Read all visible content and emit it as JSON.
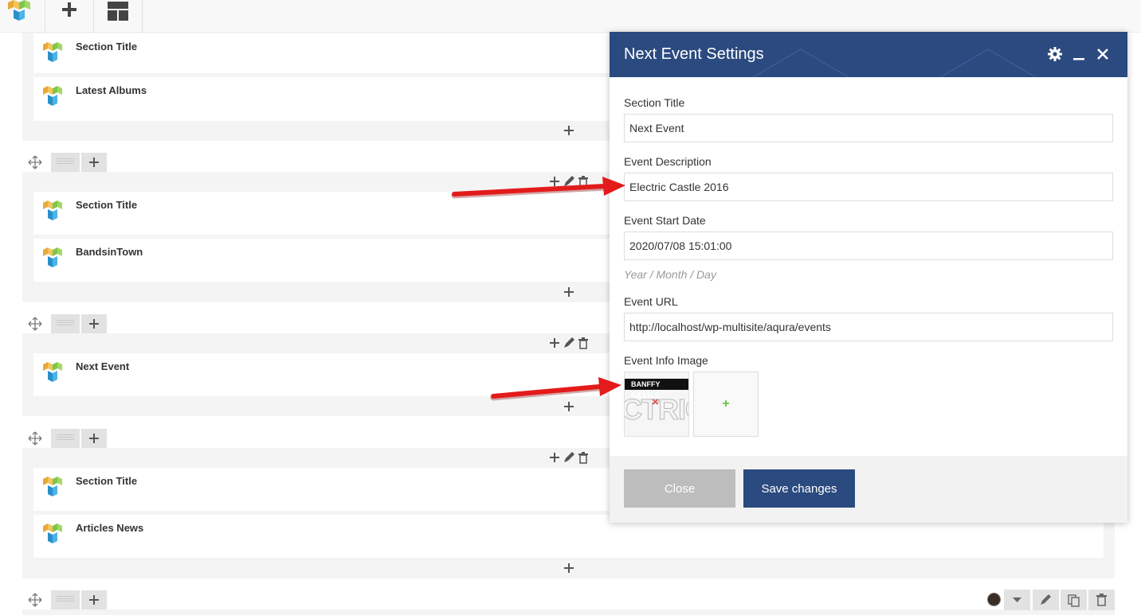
{
  "toolbar": {
    "logo_icon": "visual-composer-logo-icon",
    "add_icon": "plus-icon",
    "layout_icon": "layout-icon"
  },
  "rows": [
    {
      "elements": [
        "Section Title",
        "Latest Albums"
      ]
    },
    {
      "elements": [
        "Section Title",
        "BandsinTown"
      ]
    },
    {
      "elements": [
        "Next Event"
      ]
    },
    {
      "elements": [
        "Section Title",
        "Articles News"
      ]
    }
  ],
  "modal": {
    "title": "Next Event Settings",
    "fields": {
      "section_title": {
        "label": "Section Title",
        "value": "Next Event"
      },
      "event_description": {
        "label": "Event Description",
        "value": "Electric Castle 2016"
      },
      "event_start_date": {
        "label": "Event Start Date",
        "value": "2020/07/08 15:01:00",
        "hint": "Year / Month / Day"
      },
      "event_url": {
        "label": "Event URL",
        "value": "http://localhost/wp-multisite/aqura/events"
      },
      "event_info_image": {
        "label": "Event Info Image",
        "thumb_banner": "BANFFY CASTLE",
        "thumb_word": "CTRIC",
        "add_label": "+"
      }
    },
    "buttons": {
      "close": "Close",
      "save": "Save changes"
    }
  },
  "colors": {
    "header_blue": "#2b4a7f",
    "arrow_red": "#e31b1b",
    "add_green": "#6cc04a"
  }
}
